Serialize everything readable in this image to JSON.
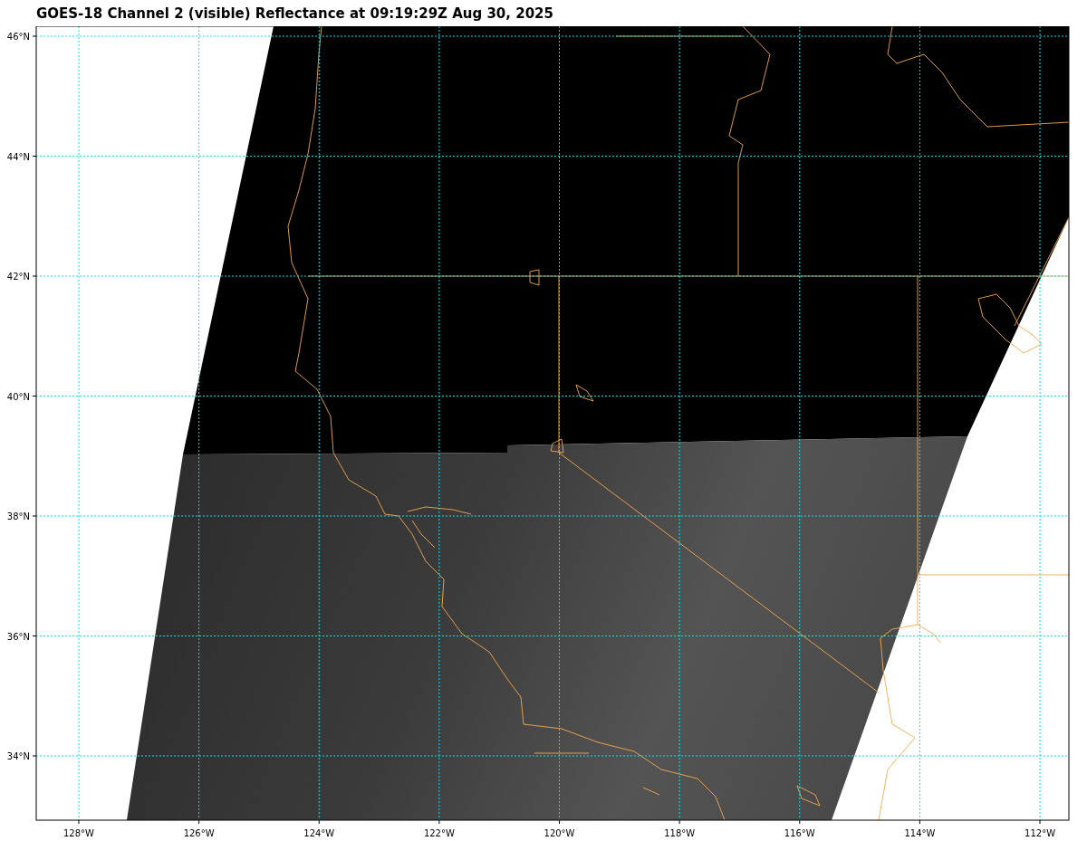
{
  "title": "GOES-18 Channel 2 (visible) Reflectance at 09:19:29Z Aug 30, 2025",
  "lat_labels": [
    "46°N",
    "44°N",
    "42°N",
    "40°N",
    "38°N",
    "36°N",
    "34°N"
  ],
  "lon_labels": [
    "128°W",
    "126°W",
    "124°W",
    "122°W",
    "120°W",
    "118°W",
    "116°W",
    "114°W",
    "112°W"
  ]
}
